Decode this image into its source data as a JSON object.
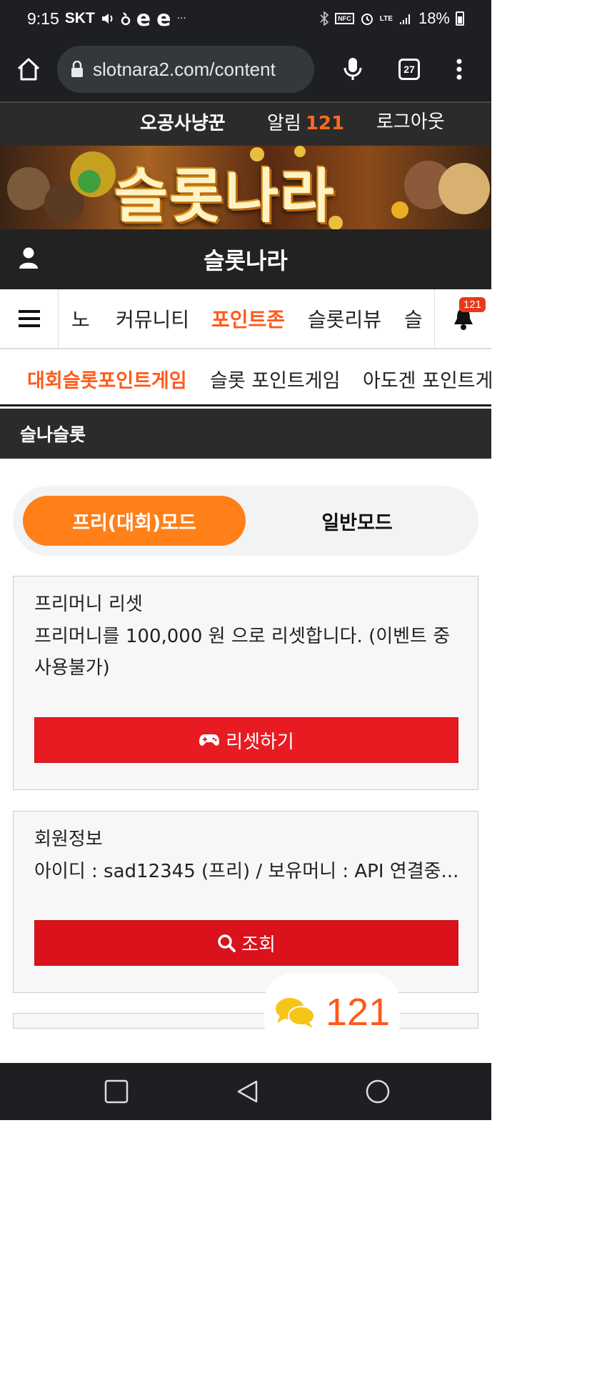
{
  "status": {
    "time": "9:15",
    "carrier": "SKT",
    "icons": [
      "volume-icon",
      "notification-icon",
      "e-icon",
      "e-icon",
      "more-icon"
    ],
    "e1": "e",
    "e2": "e",
    "dots": "···",
    "right_icons": [
      "bluetooth-icon",
      "nfc-icon",
      "alarm-icon",
      "lte-icon",
      "signal-icon"
    ],
    "nfc": "NFC",
    "lte": "LTE",
    "battery": "18%"
  },
  "browser": {
    "url": "slotnara2.com/content",
    "tabs_count": "27"
  },
  "userbar": {
    "nickname": "오공사냥꾼",
    "alarm_label": "알림",
    "alarm_count": "121",
    "logout": "로그아웃"
  },
  "banner": {
    "title": "슬롯나라"
  },
  "site": {
    "name": "슬롯나라"
  },
  "nav": {
    "items": [
      "노",
      "커뮤니티",
      "포인트존",
      "슬롯리뷰",
      "슬"
    ],
    "active_index": 2,
    "bell_badge": "121"
  },
  "subnav": {
    "items": [
      "대회슬롯포인트게임",
      "슬롯 포인트게임",
      "아도겐 포인트게"
    ]
  },
  "section": {
    "title": "슬나슬롯"
  },
  "mode": {
    "free": "프리(대회)모드",
    "normal": "일반모드"
  },
  "reset_panel": {
    "title": "프리머니 리셋",
    "desc_line1": "프리머니를 100,000 원 으로 리셋합니다. (이벤트 중",
    "desc_line2": "사용불가)",
    "button": "리셋하기"
  },
  "member_panel": {
    "title": "회원정보",
    "info": "아이디 : sad12345 (프리) / 보유머니 : API 연결중...",
    "button": "조회"
  },
  "chat": {
    "count": "121"
  },
  "colors": {
    "accent": "#ff7f19",
    "active_text": "#ff5a1a",
    "button_red": "#e81b23",
    "dark": "#222222"
  }
}
